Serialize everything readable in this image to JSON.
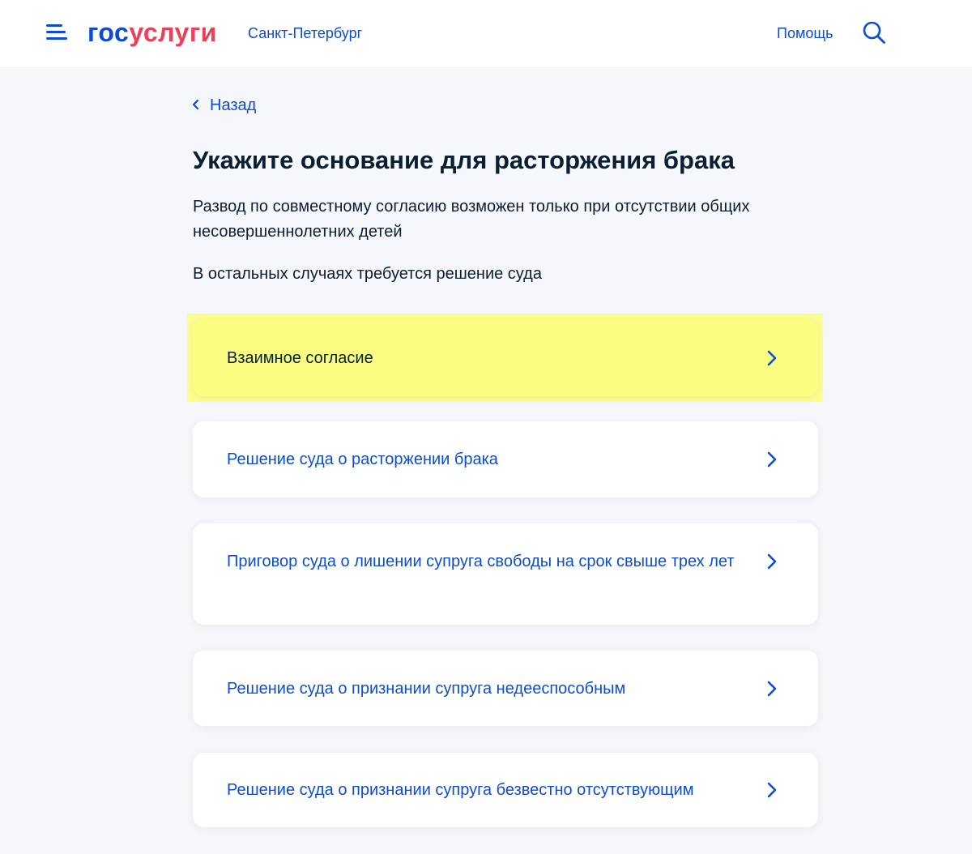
{
  "header": {
    "logo_part1": "гос",
    "logo_part2": "услуги",
    "region": "Санкт-Петербург",
    "help": "Помощь"
  },
  "icons": {
    "menu": "burger-menu-icon",
    "search": "search-icon",
    "back": "chevron-left-icon",
    "option": "chevron-right-icon"
  },
  "colors": {
    "brand_blue": "#0D4CD3",
    "brand_red": "#EE3F58",
    "text": "#0B1F33",
    "background": "#F5F7FA",
    "highlight": "#F9FE83"
  },
  "back": {
    "label": "Назад"
  },
  "page": {
    "title": "Укажите основание для расторжения брака",
    "description": "Развод по совместному согласию возможен только при отсутствии общих несовершеннолетних детей",
    "note": "В остальных случаях требуется решение суда"
  },
  "options": [
    {
      "label": "Взаимное согласие",
      "highlighted": true
    },
    {
      "label": "Решение суда о расторжении брака",
      "highlighted": false
    },
    {
      "label": "Приговор суда о лишении супруга свободы на срок свыше трех лет",
      "highlighted": false
    },
    {
      "label": "Решение суда о признании супруга недееспособным",
      "highlighted": false
    },
    {
      "label": "Решение суда о признании супруга безвестно отсутствующим",
      "highlighted": false
    }
  ]
}
